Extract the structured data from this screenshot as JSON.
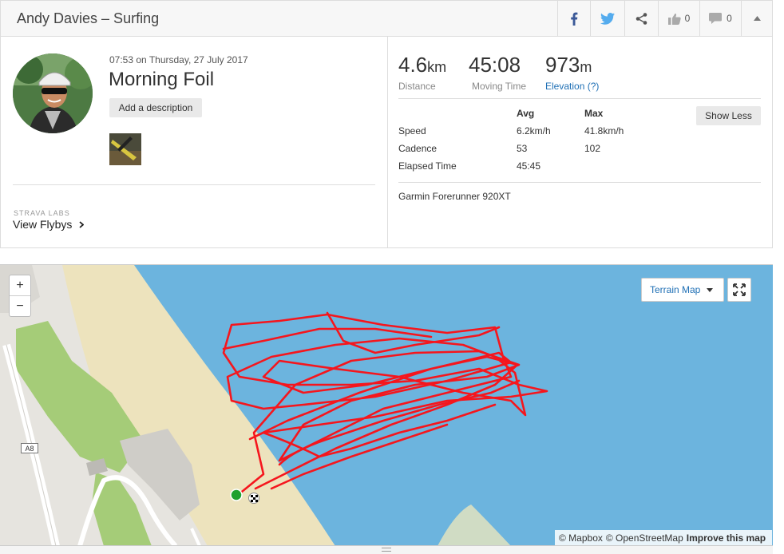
{
  "header": {
    "title": "Andy Davies – Surfing",
    "kudos_count": "0",
    "comments_count": "0"
  },
  "activity": {
    "timestamp": "07:53 on Thursday, 27 July 2017",
    "name": "Morning Foil",
    "add_description_label": "Add a description",
    "labs_label": "STRAVA LABS",
    "flybys_label": "View Flybys"
  },
  "stats": {
    "distance": {
      "value": "4.6",
      "unit": "km",
      "label": "Distance"
    },
    "moving_time": {
      "value": "45:08",
      "label": "Moving Time"
    },
    "elevation": {
      "value": "973",
      "unit": "m",
      "label": "Elevation (?)"
    },
    "col_avg": "Avg",
    "col_max": "Max",
    "rows": [
      {
        "label": "Speed",
        "avg": "6.2km/h",
        "max": "41.8km/h"
      },
      {
        "label": "Cadence",
        "avg": "53",
        "max": "102"
      },
      {
        "label": "Elapsed Time",
        "avg": "45:45",
        "max": ""
      }
    ],
    "show_less_label": "Show Less",
    "device": "Garmin Forerunner 920XT"
  },
  "map": {
    "zoom_in": "+",
    "zoom_out": "−",
    "terrain_label": "Terrain Map",
    "road_label": "A8",
    "attribution_mapbox": "© Mapbox",
    "attribution_osm": "© OpenStreetMap",
    "attribution_improve": "Improve this map",
    "water_color": "#6cb4de",
    "sand_color": "#ede3bd",
    "grass_color": "#a5cc78",
    "track_color": "#f5161d",
    "start_color": "#1fa12f",
    "facebook_color": "#3b5998",
    "twitter_color": "#55acee"
  }
}
